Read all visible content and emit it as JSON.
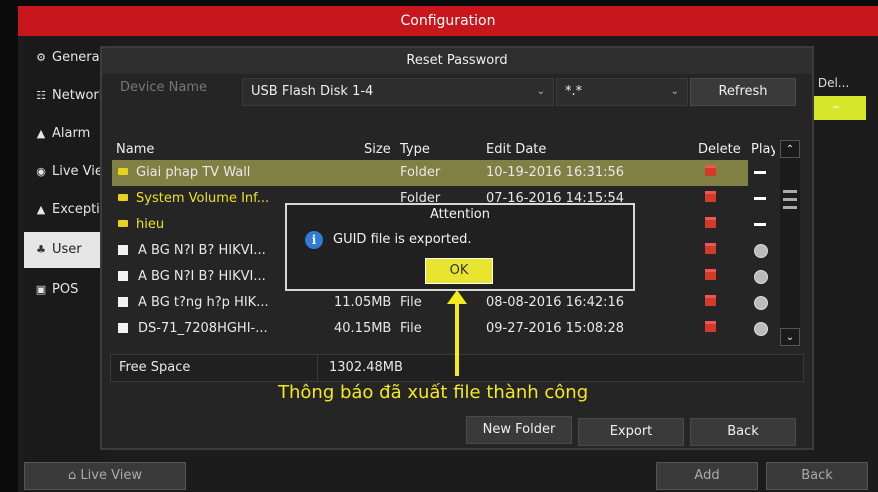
{
  "config": {
    "title": "Configuration",
    "sidebar": [
      {
        "label": "General",
        "icon": "gear-icon"
      },
      {
        "label": "Network",
        "icon": "network-icon"
      },
      {
        "label": "Alarm",
        "icon": "alarm-icon"
      },
      {
        "label": "Live View",
        "icon": "eye-icon"
      },
      {
        "label": "Exception",
        "icon": "warning-icon"
      },
      {
        "label": "User",
        "icon": "users-icon"
      },
      {
        "label": "POS",
        "icon": "pos-icon"
      }
    ],
    "right_header": "it  Del...",
    "right_cell": "–",
    "bottom": {
      "live_view": "Live View",
      "add": "Add",
      "back": "Back"
    }
  },
  "dialog": {
    "title": "Reset Password",
    "device_label": "Device Name",
    "device_value": "USB Flash Disk 1-4",
    "filter_value": "*.*",
    "refresh": "Refresh",
    "columns": {
      "name": "Name",
      "size": "Size",
      "type": "Type",
      "edit_date": "Edit Date",
      "delete": "Delete",
      "play": "Play"
    },
    "rows": [
      {
        "name": "Giai phap TV Wall",
        "size": "",
        "type": "Folder",
        "date": "10-19-2016 16:31:56",
        "kind": "folder",
        "selected": true
      },
      {
        "name": "System Volume Inf...",
        "size": "",
        "type": "Folder",
        "date": "07-16-2016 14:15:54",
        "kind": "folder",
        "selected": false
      },
      {
        "name": "hieu",
        "size": "",
        "type": "",
        "date": "",
        "kind": "folder",
        "selected": false
      },
      {
        "name": "A BG N?I B? HIKVI...",
        "size": "",
        "type": "",
        "date": "",
        "kind": "file",
        "selected": false
      },
      {
        "name": "A BG N?I B? HIKVI...",
        "size": "",
        "type": "",
        "date": "",
        "kind": "file",
        "selected": false
      },
      {
        "name": "A BG t?ng h?p HIK...",
        "size": "11.05MB",
        "type": "File",
        "date": "08-08-2016 16:42:16",
        "kind": "file",
        "selected": false
      },
      {
        "name": "DS-71_7208HGHI-...",
        "size": "40.15MB",
        "type": "File",
        "date": "09-27-2016 15:08:28",
        "kind": "file",
        "selected": false
      }
    ],
    "free_space_label": "Free Space",
    "free_space_value": "1302.48MB",
    "buttons": {
      "new_folder": "New Folder",
      "export": "Export",
      "back": "Back"
    }
  },
  "attention": {
    "title": "Attention",
    "message": "GUID file is exported.",
    "ok": "OK"
  },
  "annotation": {
    "caption": "Thông báo đã xuất file thành công",
    "color": "#f3ea1c"
  }
}
